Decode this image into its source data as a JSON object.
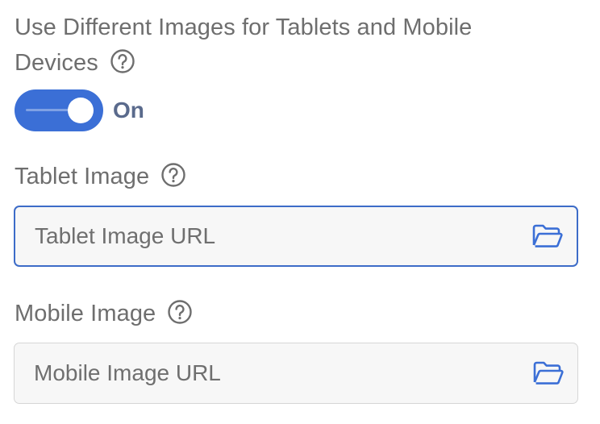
{
  "heading": {
    "line1": "Use Different Images for Tablets and Mobile",
    "line2": "Devices",
    "help_icon": "question-circle-icon"
  },
  "toggle": {
    "state_label": "On",
    "is_on": true,
    "color": "#3b6fd6"
  },
  "tablet": {
    "label": "Tablet Image",
    "help_icon": "question-circle-icon",
    "placeholder": "Tablet Image URL",
    "browse_icon": "folder-open-icon",
    "focused": true
  },
  "mobile": {
    "label": "Mobile Image",
    "help_icon": "question-circle-icon",
    "placeholder": "Mobile Image URL",
    "browse_icon": "folder-open-icon",
    "focused": false
  },
  "colors": {
    "accent": "#3b6fd6",
    "focus_border": "#3d6cc8",
    "text": "#6e6e6e"
  }
}
